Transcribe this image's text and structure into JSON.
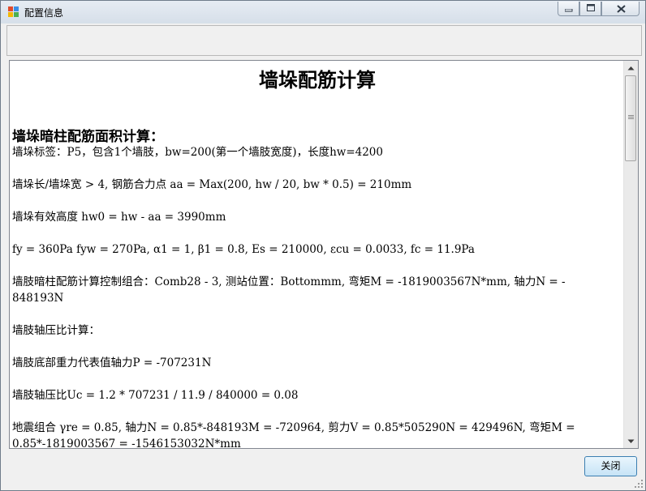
{
  "window": {
    "title": "配置信息"
  },
  "document": {
    "title": "墙垛配筋计算",
    "section_heading": "墙垛暗柱配筋面积计算：",
    "lines": [
      "墙垛标签：P5，包含1个墙肢，bw=200(第一个墙肢宽度)，长度hw=4200",
      "墙垛长/墙垛宽 > 4, 钢筋合力点 aa = Max(200, hw / 20, bw * 0.5) = 210mm",
      "墙垛有效高度 hw0 = hw - aa = 3990mm",
      "fy = 360Pa fyw = 270Pa, α1 = 1, β1 = 0.8, Es = 210000, εcu = 0.0033, fc = 11.9Pa",
      "墙肢暗柱配筋计算控制组合：Comb28 - 3, 测站位置：Bottommm, 弯矩M = -1819003567N*mm,  轴力N = -",
      "848193N",
      "墙肢轴压比计算：",
      "墙肢底部重力代表值轴力P = -707231N",
      "墙肢轴压比Uc = 1.2 * 707231 / 11.9 / 840000 = 0.08",
      "地震组合 γre = 0.85, 轴力N = 0.85*-848193M = -720964, 剪力V = 0.85*505290N = 429496N, 弯矩M =",
      "0.85*-1819003567 = -1546153032N*mm"
    ]
  },
  "buttons": {
    "close_label": "关闭"
  },
  "colors": {
    "title_bar": "#dce4ee",
    "button_border": "#3c7fb1"
  }
}
